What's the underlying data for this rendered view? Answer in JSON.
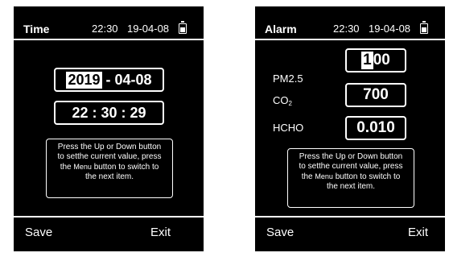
{
  "time_screen": {
    "title": "Time",
    "status_time": "22:30",
    "status_date": "19-04-08",
    "date_year": "2019",
    "date_rest": " - 04-08",
    "time_value": "22 : 30 : 29",
    "help_line1": "Press the Up or Down button",
    "help_line2": "to setthe current value, press",
    "help_line3a": "the",
    "help_menu": "Menu",
    "help_line3b": "button to switch to",
    "help_line4": "the next item.",
    "save_label": "Save",
    "exit_label": "Exit"
  },
  "alarm_screen": {
    "title": "Alarm",
    "status_time": "22:30",
    "status_date": "19-04-08",
    "pm25_label": "PM2.5",
    "pm25_digit_selected": "1",
    "pm25_value_rest": "00",
    "co2_label_main": "CO",
    "co2_label_sub": "2",
    "co2_value": "700",
    "hcho_label": "HCHO",
    "hcho_value": "0.010",
    "help_line1": "Press the Up or Down button",
    "help_line2": "to setthe current value, press",
    "help_line3a": "the",
    "help_menu": "Menu",
    "help_line3b": "button to switch to",
    "help_line4": "the next item.",
    "save_label": "Save",
    "exit_label": "Exit"
  },
  "colors": {
    "screen_bg": "#000000",
    "text": "#ffffff",
    "page_bg": "#ffffff"
  }
}
